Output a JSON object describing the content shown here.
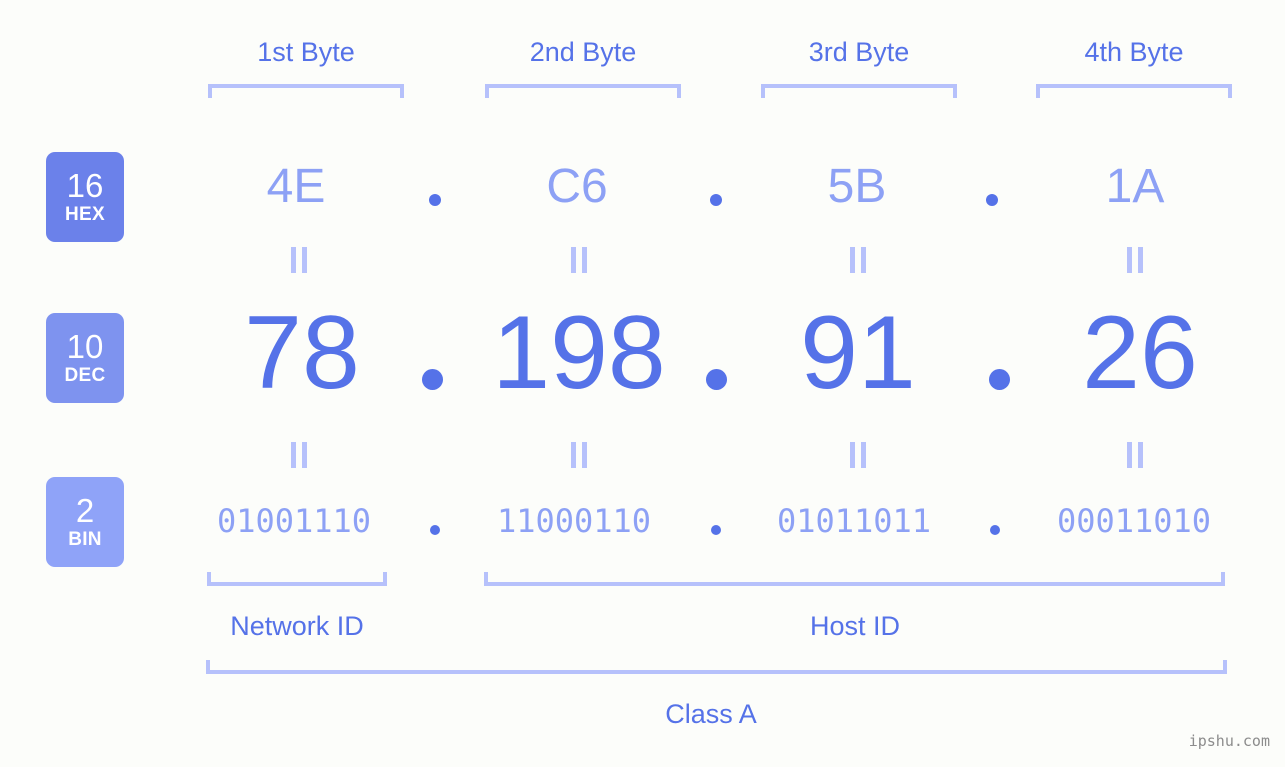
{
  "ip": {
    "dotted_decimal": "78.198.91.26",
    "class": "Class A"
  },
  "columns": [
    {
      "header": "1st Byte",
      "hex": "4E",
      "dec": "78",
      "bin": "01001110"
    },
    {
      "header": "2nd Byte",
      "hex": "C6",
      "dec": "198",
      "bin": "11000110"
    },
    {
      "header": "3rd Byte",
      "hex": "5B",
      "dec": "91",
      "bin": "01011011"
    },
    {
      "header": "4th Byte",
      "hex": "1A",
      "dec": "26",
      "bin": "00011010"
    }
  ],
  "badges": [
    {
      "base": "16",
      "system": "HEX",
      "color": "#6b81ea"
    },
    {
      "base": "10",
      "system": "DEC",
      "color": "#7e93ef"
    },
    {
      "base": "2",
      "system": "BIN",
      "color": "#8fa3f8"
    }
  ],
  "separators": {
    "hex": [
      ".",
      ".",
      "."
    ],
    "dec": [
      ".",
      ".",
      "."
    ],
    "bin": [
      ".",
      ".",
      "."
    ]
  },
  "sections": {
    "network_id": "Network ID",
    "host_id": "Host ID",
    "class_label": "Class A"
  },
  "watermark": "ipshu.com",
  "colors": {
    "background": "#fcfdfa",
    "accent_strong": "#5572e8",
    "accent_light": "#8da1f5",
    "bracket": "#b6c1fb",
    "badge_hex": "#6b81ea",
    "badge_dec": "#7e93ef",
    "badge_bin": "#8fa3f8",
    "watermark_text": "#8c8c8c"
  }
}
